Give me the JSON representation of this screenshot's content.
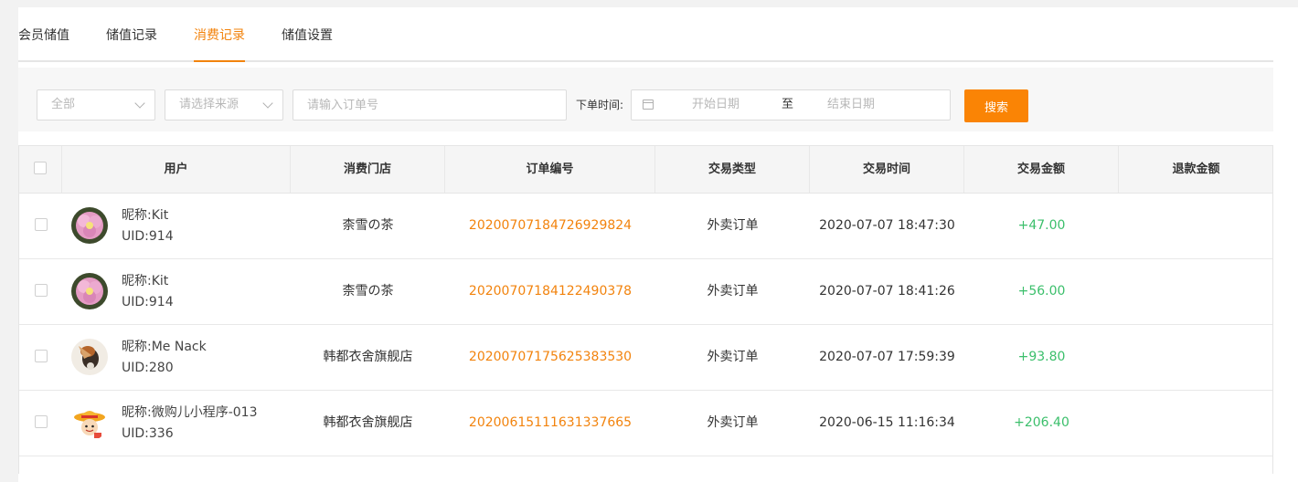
{
  "tabs": [
    {
      "label": "会员储值"
    },
    {
      "label": "储值记录"
    },
    {
      "label": "消费记录"
    },
    {
      "label": "储值设置"
    }
  ],
  "active_tab_index": 2,
  "filters": {
    "type_select": {
      "value": "全部"
    },
    "source_select": {
      "placeholder": "请选择来源"
    },
    "order_input": {
      "placeholder": "请输入订单号"
    },
    "date_label": "下单时间:",
    "date_start": "开始日期",
    "date_sep": "至",
    "date_end": "结束日期",
    "search_label": "搜索"
  },
  "table": {
    "headers": [
      "用户",
      "消费门店",
      "订单编号",
      "交易类型",
      "交易时间",
      "交易金额",
      "退款金额"
    ],
    "rows": [
      {
        "nickname": "昵称:Kit",
        "uid": "UID:914",
        "store": "柰雪の茶",
        "order": "20200707184726929824",
        "type": "外卖订单",
        "time": "2020-07-07 18:47:30",
        "amount": "+47.00",
        "refund": "",
        "avatar": "flower-avatar"
      },
      {
        "nickname": "昵称:Kit",
        "uid": "UID:914",
        "store": "柰雪の茶",
        "order": "20200707184122490378",
        "type": "外卖订单",
        "time": "2020-07-07 18:41:26",
        "amount": "+56.00",
        "refund": "",
        "avatar": "flower-avatar"
      },
      {
        "nickname": "昵称:Me Nack",
        "uid": "UID:280",
        "store": "韩都衣舍旗舰店",
        "order": "20200707175625383530",
        "type": "外卖订单",
        "time": "2020-07-07 17:59:39",
        "amount": "+93.80",
        "refund": "",
        "avatar": "bird-avatar"
      },
      {
        "nickname": "昵称:微购儿小程序-013",
        "uid": "UID:336",
        "store": "韩都衣舍旗舰店",
        "order": "20200615111631337665",
        "type": "外卖订单",
        "time": "2020-06-15 11:16:34",
        "amount": "+206.40",
        "refund": "",
        "avatar": "cartoon-hat-avatar"
      }
    ]
  }
}
